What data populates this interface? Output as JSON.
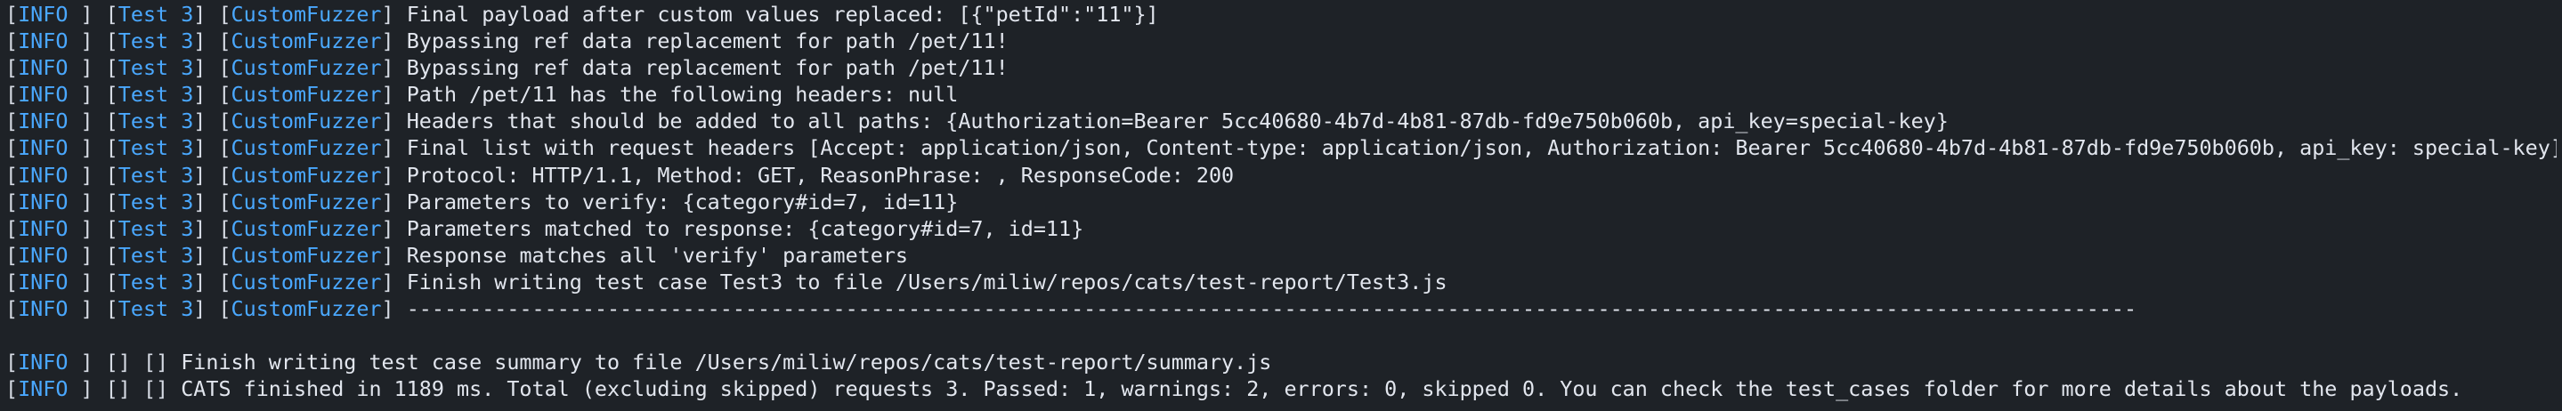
{
  "terminal": {
    "lines": [
      {
        "level": "INFO",
        "test": "Test 3",
        "fuzzer": "CustomFuzzer",
        "message": "Final payload after custom values replaced: [{\"petId\":\"11\"}]"
      },
      {
        "level": "INFO",
        "test": "Test 3",
        "fuzzer": "CustomFuzzer",
        "message": "Bypassing ref data replacement for path /pet/11!"
      },
      {
        "level": "INFO",
        "test": "Test 3",
        "fuzzer": "CustomFuzzer",
        "message": "Bypassing ref data replacement for path /pet/11!"
      },
      {
        "level": "INFO",
        "test": "Test 3",
        "fuzzer": "CustomFuzzer",
        "message": "Path /pet/11 has the following headers: null"
      },
      {
        "level": "INFO",
        "test": "Test 3",
        "fuzzer": "CustomFuzzer",
        "message": "Headers that should be added to all paths: {Authorization=Bearer 5cc40680-4b7d-4b81-87db-fd9e750b060b, api_key=special-key}"
      },
      {
        "level": "INFO",
        "test": "Test 3",
        "fuzzer": "CustomFuzzer",
        "message": "Final list with request headers [Accept: application/json, Content-type: application/json, Authorization: Bearer 5cc40680-4b7d-4b81-87db-fd9e750b060b, api_key: special-key]"
      },
      {
        "level": "INFO",
        "test": "Test 3",
        "fuzzer": "CustomFuzzer",
        "message": "Protocol: HTTP/1.1, Method: GET, ReasonPhrase: , ResponseCode: 200"
      },
      {
        "level": "INFO",
        "test": "Test 3",
        "fuzzer": "CustomFuzzer",
        "message": "Parameters to verify: {category#id=7, id=11}"
      },
      {
        "level": "INFO",
        "test": "Test 3",
        "fuzzer": "CustomFuzzer",
        "message": "Parameters matched to response: {category#id=7, id=11}"
      },
      {
        "level": "INFO",
        "test": "Test 3",
        "fuzzer": "CustomFuzzer",
        "message": "Response matches all 'verify' parameters"
      },
      {
        "level": "INFO",
        "test": "Test 3",
        "fuzzer": "CustomFuzzer",
        "message": "Finish writing test case Test3 to file /Users/miliw/repos/cats/test-report/Test3.js"
      },
      {
        "level": "INFO",
        "test": "Test 3",
        "fuzzer": "CustomFuzzer",
        "message": "------------------------------------------------------------------------------------------------------------------------------------------"
      },
      {
        "level": "INFO",
        "test": "",
        "fuzzer": "",
        "message": "Finish writing test case summary to file /Users/miliw/repos/cats/test-report/summary.js"
      },
      {
        "level": "INFO",
        "test": "",
        "fuzzer": "",
        "message": "CATS finished in 1189 ms. Total (excluding skipped) requests 3. Passed: 1, warnings: 2, errors: 0, skipped 0. You can check the test_cases folder for more details about the payloads."
      }
    ]
  }
}
